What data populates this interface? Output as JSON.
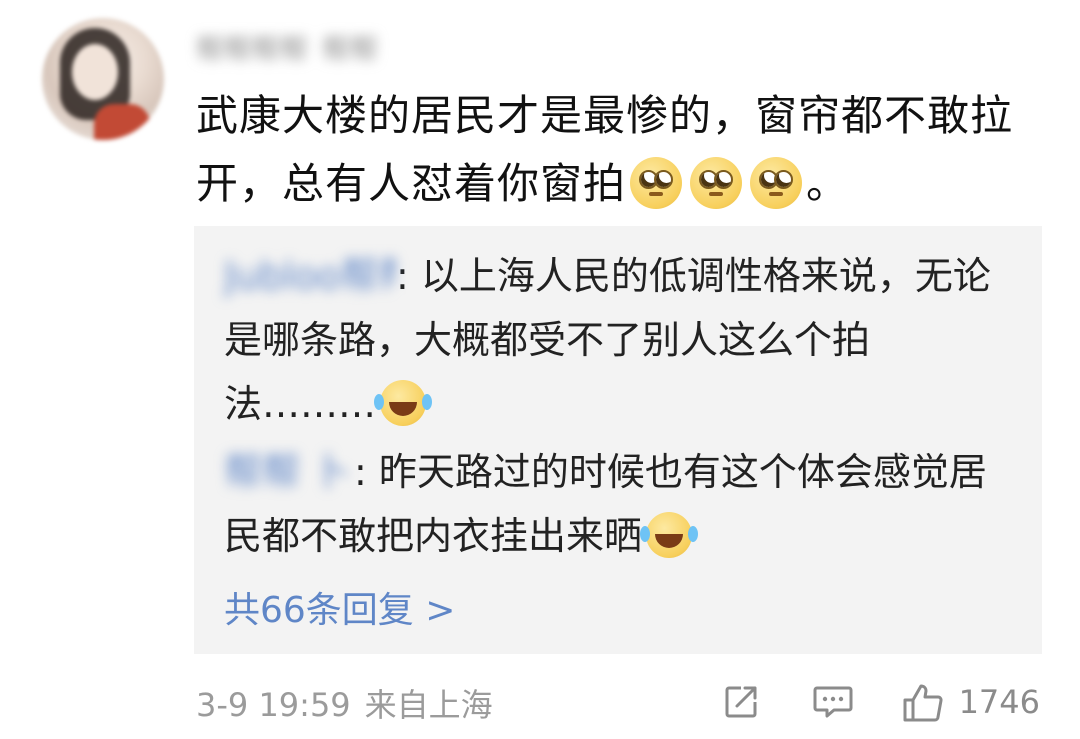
{
  "comment": {
    "author": "帮帮帮帮_帮帮",
    "text_part1": "武康大楼的居民才是最惨的，窗帘都不敢拉开，总有人怼着你窗拍",
    "text_part2": "。",
    "emojis": [
      "eye-roll-emoji",
      "eye-roll-emoji",
      "eye-roll-emoji"
    ]
  },
  "replies": [
    {
      "name": "Jubloo帮帮",
      "text": ": 以上海人民的低调性格来说，无论是哪条路，大概都受不了别人这么个拍法………",
      "emoji": "crying-laughing-emoji"
    },
    {
      "name": "帮帮 卜",
      "text": ": 昨天路过的时候也有这个体会感觉居民都不敢把内衣挂出来晒",
      "emoji": "crying-laughing-emoji"
    }
  ],
  "more_replies": "共66条回复 >",
  "footer": {
    "date": "3-9 19:59",
    "source": "来自上海",
    "like_count": "1746"
  },
  "icons": {
    "share": "share-icon",
    "comment": "comment-icon",
    "like": "thumbs-up-icon"
  },
  "colors": {
    "link": "#5f86c7",
    "reply_bg": "#f3f3f3",
    "meta": "#9b9b9b"
  }
}
